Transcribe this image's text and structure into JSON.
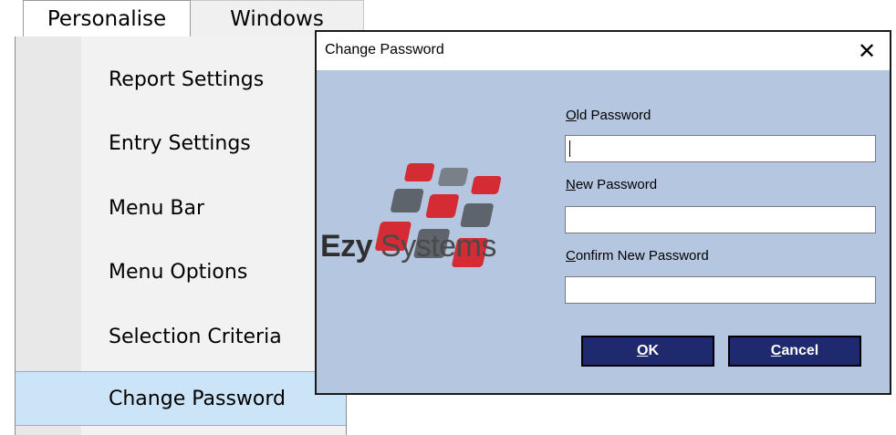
{
  "menubar": {
    "tabs": [
      {
        "label": "Personalise"
      },
      {
        "label": "Windows"
      }
    ]
  },
  "dropdown": {
    "items": [
      {
        "label": "Report Settings"
      },
      {
        "label": "Entry Settings"
      },
      {
        "label": "Menu Bar"
      },
      {
        "label": "Menu Options"
      },
      {
        "label": "Selection Criteria"
      },
      {
        "label": "Change Password",
        "selected": true
      }
    ]
  },
  "dialog": {
    "title": "Change Password",
    "close_icon": "close-icon",
    "logo": {
      "brand_bold": "Ezy",
      "brand_rest": " Systems",
      "tile_colors": {
        "red": "#d42b34",
        "gray": "#5e646b"
      }
    },
    "fields": [
      {
        "label_access": "O",
        "label_rest": "ld Password",
        "value": ""
      },
      {
        "label_access": "N",
        "label_rest": "ew Password",
        "value": ""
      },
      {
        "label_access": "C",
        "label_rest": "onfirm New Password",
        "value": ""
      }
    ],
    "buttons": {
      "ok": {
        "access": "O",
        "rest": "K"
      },
      "cancel": {
        "access": "C",
        "rest": "ancel"
      }
    }
  },
  "colors": {
    "dialog_client": "#b5c7e0",
    "button_bg": "#1f2a6e",
    "menu_selected": "#cce4f7"
  }
}
